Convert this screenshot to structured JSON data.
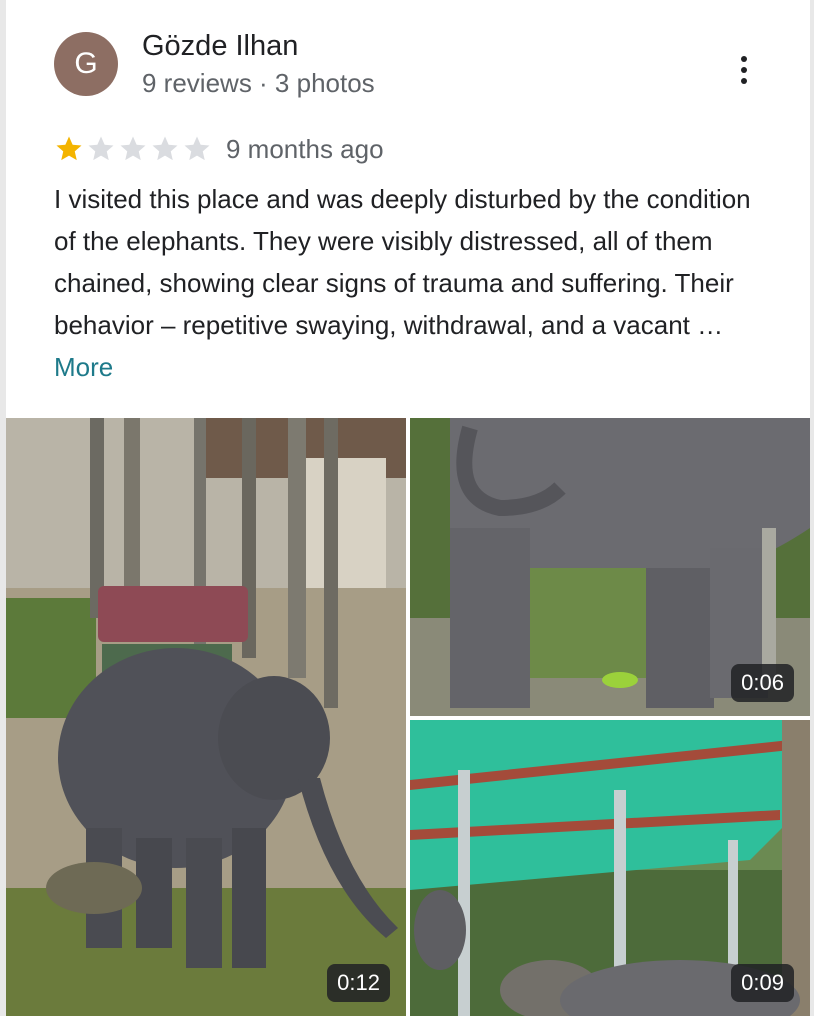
{
  "reviewer": {
    "avatar_letter": "G",
    "avatar_color": "#8d6e63",
    "name": "Gözde Ilhan",
    "meta": "9 reviews · 3 photos"
  },
  "review": {
    "rating": 1,
    "max_rating": 5,
    "time": "9 months ago",
    "text": "I visited this place and was deeply disturbed by the condition of the elephants. They were visibly distressed, all of them chained, showing clear signs of trauma and suffering. Their behavior – repetitive swaying, withdrawal, and a vacant …",
    "more_label": "More"
  },
  "colors": {
    "star_filled": "#f4b400",
    "star_empty": "#dadce0",
    "link": "#1e7a8a"
  },
  "media": [
    {
      "kind": "video",
      "duration": "0:12",
      "subject": "elephant with seat"
    },
    {
      "kind": "video",
      "duration": "0:06",
      "subject": "elephant legs"
    },
    {
      "kind": "video",
      "duration": "0:09",
      "subject": "elephants under green shade"
    }
  ]
}
